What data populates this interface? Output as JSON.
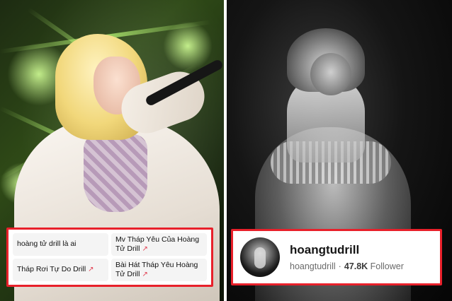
{
  "search_suggestions": [
    {
      "text": "hoàng tử drill là ai",
      "trending": false
    },
    {
      "text": "Mv Tháp Yêu Của Hoàng Tử Drill",
      "trending": true
    },
    {
      "text": "Tháp Rơi Tự Do Drill",
      "trending": true
    },
    {
      "text": "Bài Hát Tháp Yêu Hoàng Tử Drill",
      "trending": true
    }
  ],
  "trend_icon": "trending-up-icon",
  "profile": {
    "display_name": "hoangtudrill",
    "username": "hoangtudrill",
    "separator": "·",
    "follower_count": "47.8K",
    "follower_label": "Follower"
  },
  "colors": {
    "highlight_border": "#e8202a",
    "trend": "#e23b4e"
  }
}
